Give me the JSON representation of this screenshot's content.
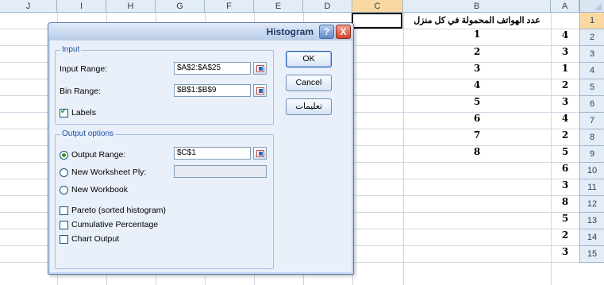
{
  "columns": [
    "J",
    "I",
    "H",
    "G",
    "F",
    "E",
    "D",
    "C",
    "B",
    "A"
  ],
  "rows": [
    "1",
    "2",
    "3",
    "4",
    "5",
    "6",
    "7",
    "8",
    "9",
    "10",
    "11",
    "12",
    "13",
    "14",
    "15"
  ],
  "cell_B1": "عدد الهواتف المحمولة في كل منزل",
  "col_B_values": [
    "1",
    "2",
    "3",
    "4",
    "5",
    "6",
    "7",
    "8"
  ],
  "col_A_values": [
    "4",
    "3",
    "1",
    "2",
    "3",
    "4",
    "2",
    "5",
    "6",
    "3",
    "8",
    "5",
    "2",
    "3"
  ],
  "dialog": {
    "title": "Histogram",
    "help_label": "?",
    "close_label": "X",
    "input_group": "Input",
    "input_range_label": "Input Range:",
    "input_range_value": "$A$2:$A$25",
    "bin_range_label": "Bin Range:",
    "bin_range_value": "$B$1:$B$9",
    "labels_label": "Labels",
    "output_group": "Output options",
    "output_range_label": "Output Range:",
    "output_range_value": "$C$1",
    "new_worksheet_label": "New Worksheet Ply:",
    "new_workbook_label": "New Workbook",
    "pareto_label": "Pareto (sorted histogram)",
    "cumulative_label": "Cumulative Percentage",
    "chart_output_label": "Chart Output",
    "ok_label": "OK",
    "cancel_label": "Cancel",
    "help_button_label": "تعليمات"
  },
  "colors": {
    "header_bg": "#e4ecf7",
    "selected_header": "#f9d99f",
    "dialog_bg": "#e9f0fa",
    "group_label": "#1f4fa3"
  }
}
